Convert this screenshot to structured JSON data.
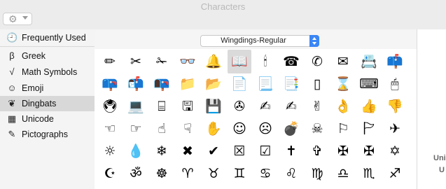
{
  "window": {
    "title": "Characters"
  },
  "toolbar": {
    "gear_icon": "gear-icon"
  },
  "sidebar": {
    "items": [
      {
        "label": "Frequently Used",
        "icon": "🕘",
        "icon_name": "clock-icon"
      },
      {
        "label": "Greek",
        "icon": "β",
        "icon_name": "beta-icon"
      },
      {
        "label": "Math Symbols",
        "icon": "√",
        "icon_name": "square-root-icon"
      },
      {
        "label": "Emoji",
        "icon": "☺",
        "icon_name": "smiley-icon"
      },
      {
        "label": "Dingbats",
        "icon": "❦",
        "icon_name": "floral-heart-icon"
      },
      {
        "label": "Unicode",
        "icon": "▦",
        "icon_name": "grid-icon"
      },
      {
        "label": "Pictographs",
        "icon": "✎",
        "icon_name": "pencil-icon"
      }
    ],
    "selected": "Dingbats"
  },
  "font_selector": {
    "value": "Wingdings-Regular"
  },
  "glyphs": {
    "selected_index": 5,
    "rows": [
      [
        "✏",
        "✂",
        "✁",
        "👓",
        "🔔",
        "📖",
        "🕯",
        "☎",
        "✆",
        "✉",
        "📇",
        "📫"
      ],
      [
        "📪",
        "📬",
        "📭",
        "📁",
        "📂",
        "📄",
        "📃",
        "📑",
        "▯",
        "⌛",
        "⌨",
        "🖱"
      ],
      [
        "🖲",
        "💻",
        "⌸",
        "🖫",
        "💾",
        "✇",
        "✍",
        "✍",
        "✌",
        "👌",
        "👍",
        "👎"
      ],
      [
        "☜",
        "☞",
        "☝",
        "☟",
        "✋",
        "☺",
        "☹",
        "💣",
        "☠",
        "⚐",
        "🏱",
        "✈"
      ],
      [
        "☼",
        "💧",
        "❄",
        "✖",
        "✔",
        "☒",
        "☑",
        "✝",
        "✞",
        "✠",
        "✠",
        "✡"
      ],
      [
        "☪",
        "ॐ",
        "☸",
        "♈",
        "♉",
        "♊",
        "♋",
        "♌",
        "♍",
        "♎",
        "♏",
        "♐"
      ]
    ]
  },
  "info_panel": {
    "line1": "Uni",
    "line2": "U"
  }
}
